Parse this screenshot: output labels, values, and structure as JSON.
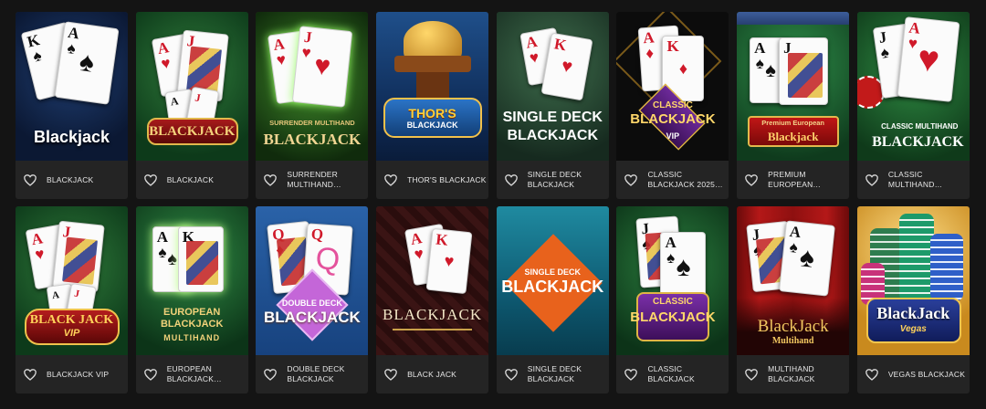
{
  "games": [
    {
      "name": "BLACKJACK",
      "logo": "Blackjack",
      "sub": ""
    },
    {
      "name": "BLACKJACK",
      "logo": "BLACKJACK",
      "sub": ""
    },
    {
      "name": "SURRENDER MULTIHAND…",
      "logo": "BLACKJACK",
      "sub": "SURRENDER MULTIHAND"
    },
    {
      "name": "THOR'S BLACKJACK",
      "logo": "THOR'S",
      "sub": "BLACKJACK"
    },
    {
      "name": "SINGLE DECK BLACKJACK",
      "logo": "SINGLE DECK",
      "sub": "BLACKJACK"
    },
    {
      "name": "CLASSIC BLACKJACK 2025…",
      "logo": "BLACKJACK",
      "sub": "CLASSIC",
      "badge": "VIP"
    },
    {
      "name": "PREMIUM EUROPEAN…",
      "logo": "Blackjack",
      "sub": "Premium European"
    },
    {
      "name": "CLASSIC MULTIHAND…",
      "logo": "BLACKJACK",
      "sub": "CLASSIC MULTIHAND"
    },
    {
      "name": "BLACKJACK VIP",
      "logo": "BLACK JACK",
      "sub": "VIP"
    },
    {
      "name": "EUROPEAN BLACKJACK…",
      "logo": "EUROPEAN BLACKJACK",
      "sub": "MULTIHAND"
    },
    {
      "name": "DOUBLE DECK BLACKJACK",
      "logo": "BLACKJACK",
      "sub": "DOUBLE DECK"
    },
    {
      "name": "BLACK JACK",
      "logo": "BLACKJACK",
      "sub": ""
    },
    {
      "name": "SINGLE DECK BLACKJACK",
      "logo": "BLACKJACK",
      "sub": "SINGLE DECK"
    },
    {
      "name": "CLASSIC BLACKJACK",
      "logo": "BLACKJACK",
      "sub": "CLASSIC"
    },
    {
      "name": "MULTIHAND BLACKJACK",
      "logo": "BlackJack",
      "sub": "Multihand"
    },
    {
      "name": "VEGAS BLACKJACK",
      "logo": "BlackJack",
      "sub": "Vegas"
    }
  ],
  "icons": {
    "favorite": "heart-outline-icon"
  },
  "colors": {
    "card_bg": "#242424",
    "page_bg": "#141414",
    "text": "#e6e6e6"
  }
}
